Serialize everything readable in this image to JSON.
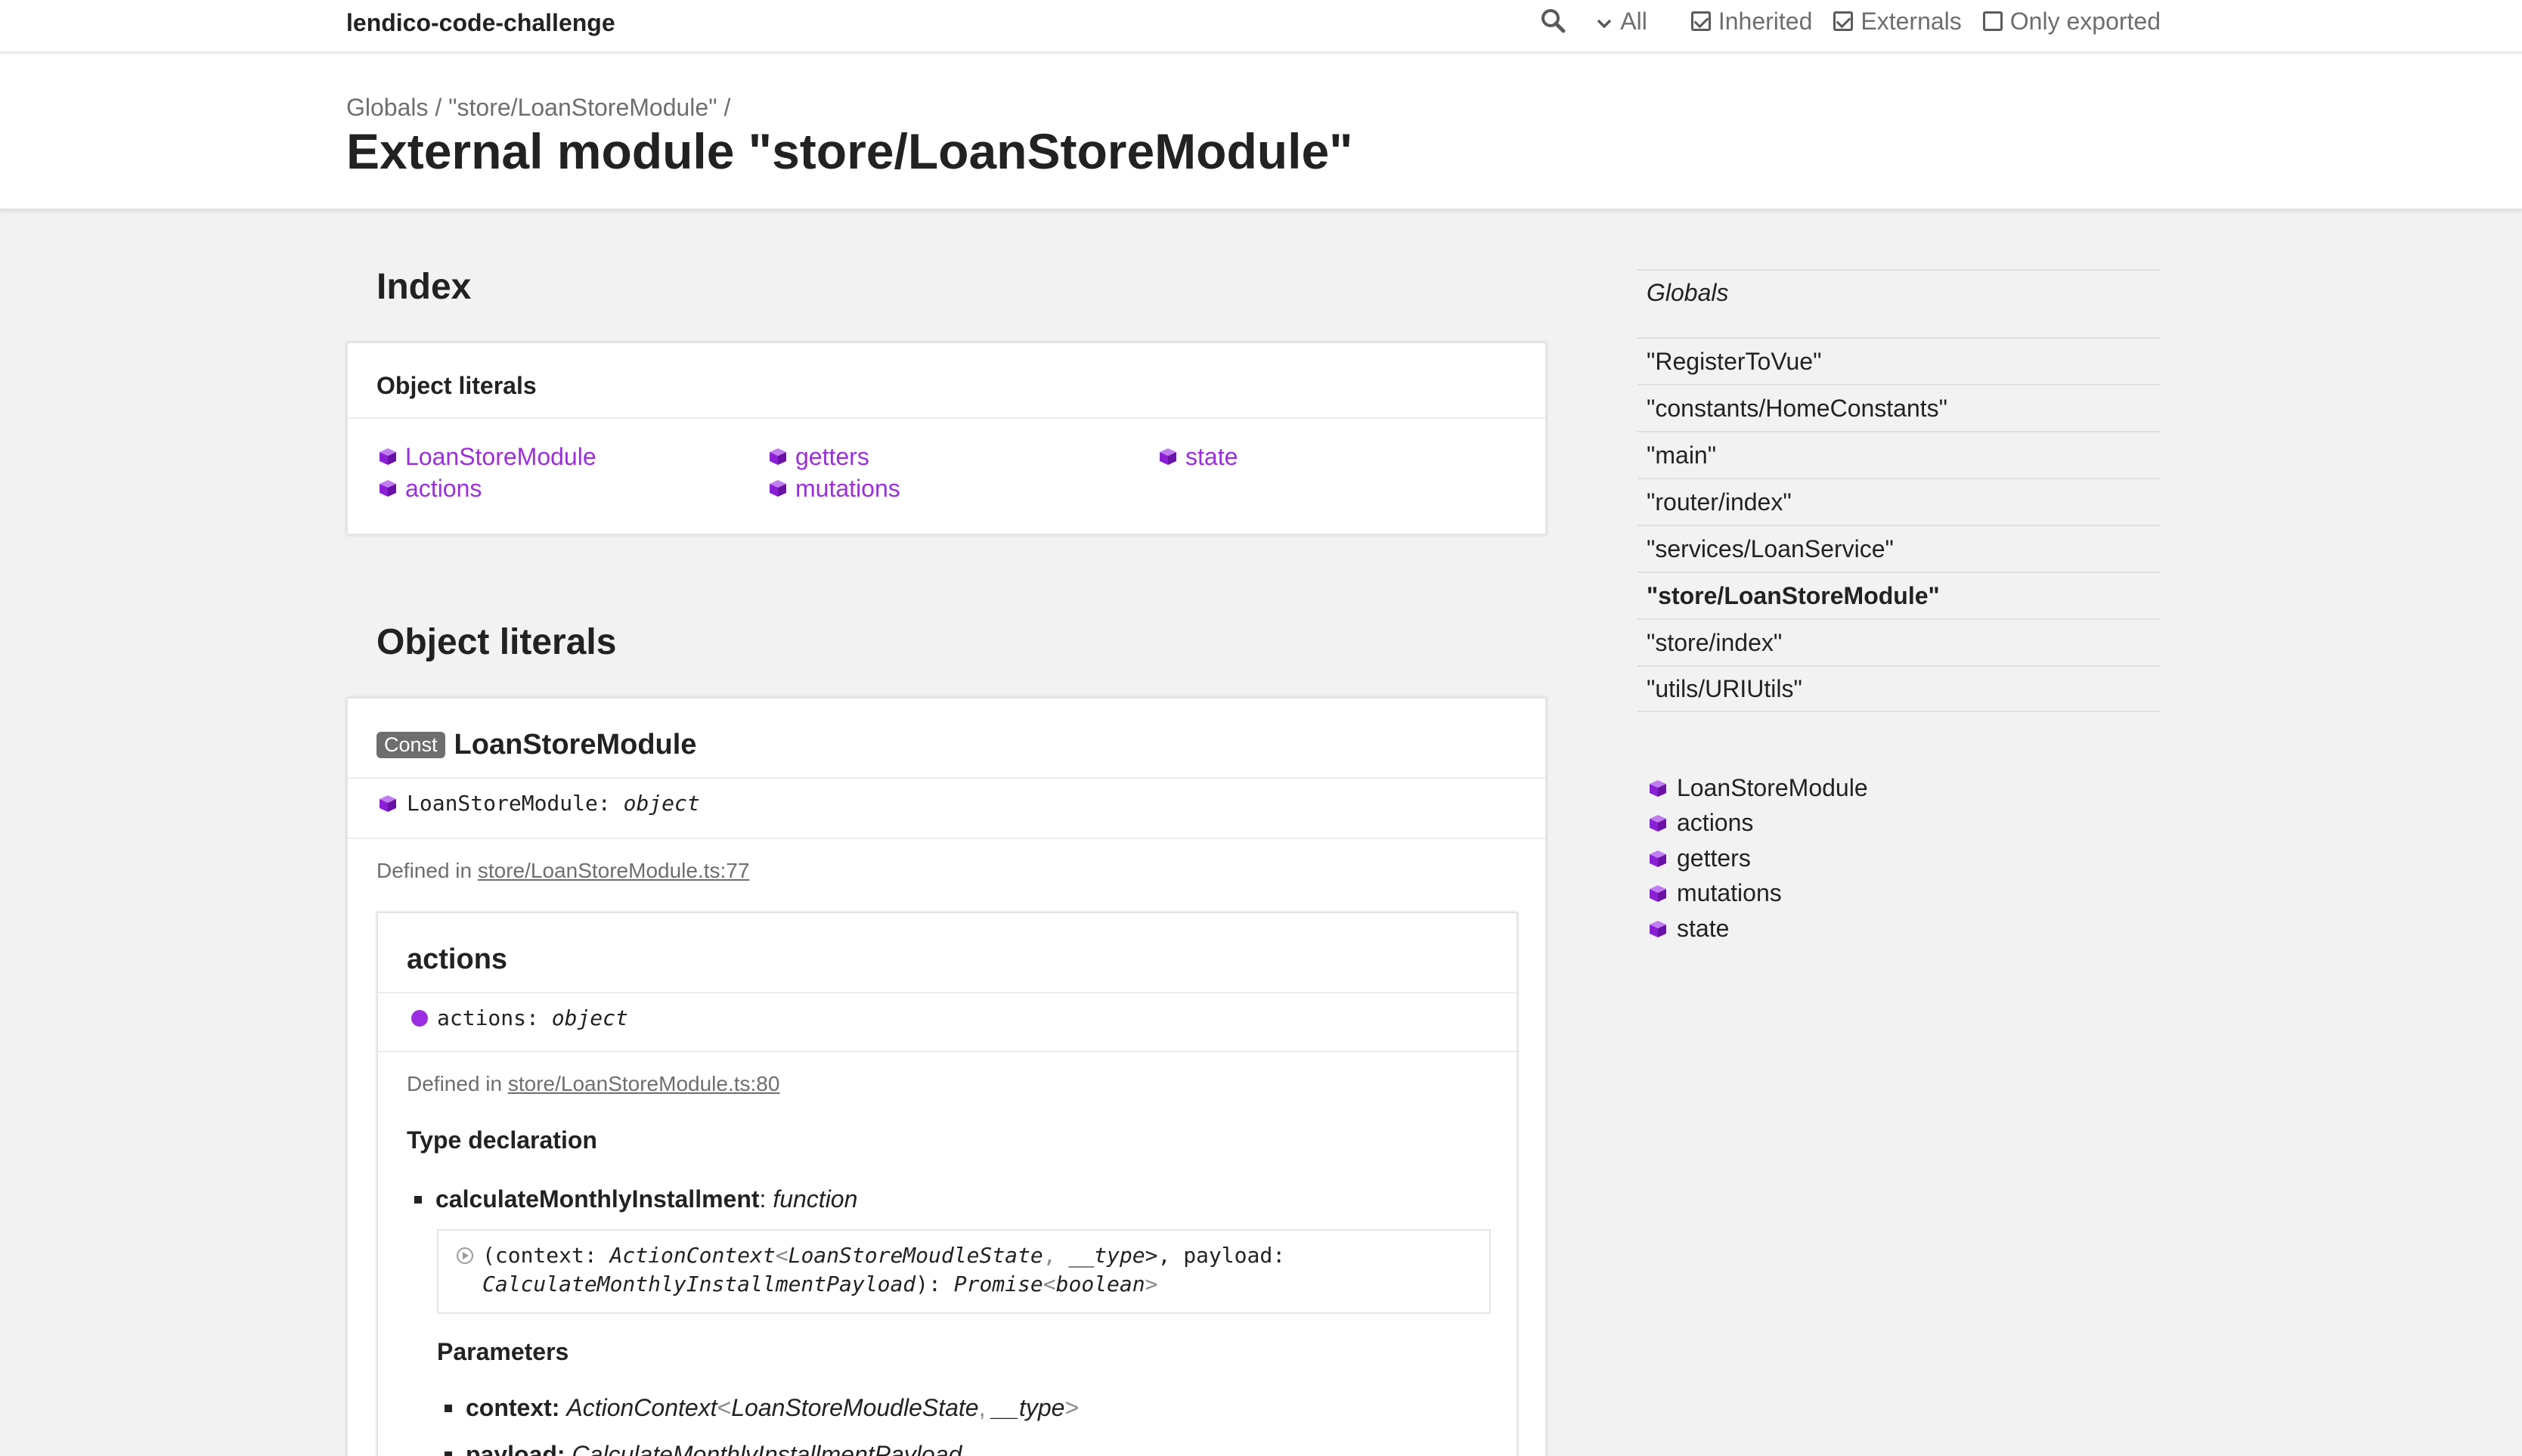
{
  "toolbar": {
    "project_title": "lendico-code-challenge",
    "search_icon": "search-icon",
    "filter_value": "All",
    "options": [
      {
        "label": "Inherited",
        "checked": true
      },
      {
        "label": "Externals",
        "checked": true
      },
      {
        "label": "Only exported",
        "checked": false
      }
    ]
  },
  "header": {
    "breadcrumb": [
      "Globals",
      " / ",
      "\"store/LoanStoreModule\"",
      " /"
    ],
    "title": "External module \"store/LoanStoreModule\""
  },
  "index": {
    "title": "Index",
    "group_title": "Object literals",
    "links": [
      "LoanStoreModule",
      "actions",
      "getters",
      "mutations",
      "state"
    ]
  },
  "object_literals": {
    "title": "Object literals",
    "member": {
      "badge": "Const",
      "name": "LoanStoreModule",
      "signature_name": "LoanStoreModule",
      "signature_sep": ":",
      "signature_type": "object",
      "defined_prefix": "Defined in ",
      "defined_link": "store/LoanStoreModule.ts:77"
    },
    "actions": {
      "name": "actions",
      "signature_name": "actions",
      "signature_sep": ":",
      "signature_type": "object",
      "defined_prefix": "Defined in ",
      "defined_link": "store/LoanStoreModule.ts:80",
      "type_declaration_title": "Type declaration",
      "fn_name": "calculateMonthlyInstallment",
      "fn_sep": ": ",
      "fn_type": "function",
      "sig_line1_a": "(context: ",
      "sig_line1_b": "ActionContext",
      "sig_line1_c": "<",
      "sig_line1_d": "LoanStoreMoudleState",
      "sig_line1_e": ", ",
      "sig_line1_f": "__type",
      "sig_line1_g": ">, payload:",
      "sig_line2_a": "CalculateMonthlyInstallmentPayload",
      "sig_line2_b": "): ",
      "sig_line2_c": "Promise",
      "sig_line2_d": "<",
      "sig_line2_e": "boolean",
      "sig_line2_f": ">",
      "parameters_title": "Parameters",
      "param1_name": "context:",
      "param1_type_a": "ActionContext",
      "param1_type_b": "<",
      "param1_type_c": "LoanStoreMoudleState",
      "param1_type_d": ", ",
      "param1_type_e": "__type",
      "param1_type_f": ">",
      "param2_name": "payload:",
      "param2_type": "CalculateMonthlyInstallmentPayload"
    }
  },
  "sidebar": {
    "globals_label": "Globals",
    "modules": [
      "\"RegisterToVue\"",
      "\"constants/HomeConstants\"",
      "\"main\"",
      "\"router/index\"",
      "\"services/LoanService\"",
      "\"store/LoanStoreModule\"",
      "\"store/index\"",
      "\"utils/URIUtils\""
    ],
    "current_index": 5,
    "members": [
      "LoanStoreModule",
      "actions",
      "getters",
      "mutations",
      "state"
    ]
  },
  "colors": {
    "accent": "#9a2ee0",
    "muted": "#6e6e6e",
    "text": "#222222",
    "background": "#f2f2f2"
  }
}
